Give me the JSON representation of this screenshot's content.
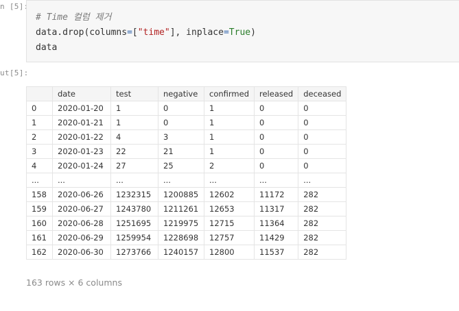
{
  "input_prompt": "n [5]:",
  "output_prompt": "ut[5]:",
  "code": {
    "comment": "# Time 컬럼 제거",
    "line2": {
      "obj": "data.drop(columns",
      "eq1": "=",
      "bracket_open": "[",
      "string": "\"time\"",
      "bracket_close": "], inplace",
      "eq2": "=",
      "true": "True",
      "close": ")"
    },
    "line3": "data"
  },
  "table": {
    "columns": [
      "",
      "date",
      "test",
      "negative",
      "confirmed",
      "released",
      "deceased"
    ],
    "rows": [
      [
        "0",
        "2020-01-20",
        "1",
        "0",
        "1",
        "0",
        "0"
      ],
      [
        "1",
        "2020-01-21",
        "1",
        "0",
        "1",
        "0",
        "0"
      ],
      [
        "2",
        "2020-01-22",
        "4",
        "3",
        "1",
        "0",
        "0"
      ],
      [
        "3",
        "2020-01-23",
        "22",
        "21",
        "1",
        "0",
        "0"
      ],
      [
        "4",
        "2020-01-24",
        "27",
        "25",
        "2",
        "0",
        "0"
      ],
      [
        "...",
        "...",
        "...",
        "...",
        "...",
        "...",
        "..."
      ],
      [
        "158",
        "2020-06-26",
        "1232315",
        "1200885",
        "12602",
        "11172",
        "282"
      ],
      [
        "159",
        "2020-06-27",
        "1243780",
        "1211261",
        "12653",
        "11317",
        "282"
      ],
      [
        "160",
        "2020-06-28",
        "1251695",
        "1219975",
        "12715",
        "11364",
        "282"
      ],
      [
        "161",
        "2020-06-29",
        "1259954",
        "1228698",
        "12757",
        "11429",
        "282"
      ],
      [
        "162",
        "2020-06-30",
        "1273766",
        "1240157",
        "12800",
        "11537",
        "282"
      ]
    ]
  },
  "shape_note": "163 rows × 6 columns"
}
